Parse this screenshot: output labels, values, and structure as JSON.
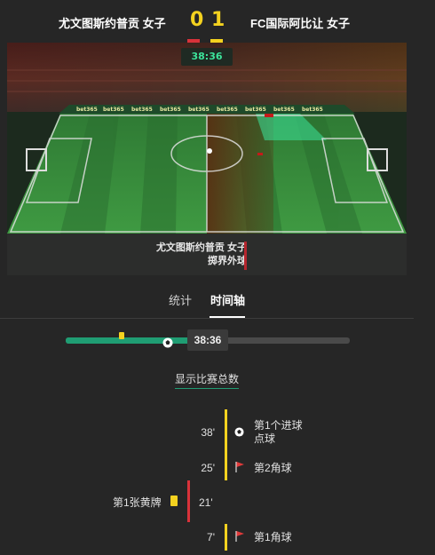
{
  "header": {
    "home_team": "尤文图斯约普贡 女子",
    "away_team": "FC国际阿比让 女子",
    "home_score": "0",
    "away_score": "1"
  },
  "pitch": {
    "clock": "38:36",
    "sponsor": "bet365",
    "event_team": "尤文图斯约普贡 女子",
    "event_desc": "掷界外球"
  },
  "tabs": {
    "stats": "统计",
    "timeline": "时间轴"
  },
  "progress": {
    "time": "38:36",
    "fraction": 0.43
  },
  "show_total": "显示比赛总数",
  "timeline": [
    {
      "minute": "38'",
      "side": "away",
      "icon": "football-icon",
      "line1": "第1个进球",
      "line2": "点球"
    },
    {
      "minute": "25'",
      "side": "away",
      "icon": "corner-flag-icon",
      "line1": "第2角球",
      "line2": ""
    },
    {
      "minute": "21'",
      "side": "home",
      "icon": "yellow-card-icon",
      "line1": "第1张黄牌",
      "line2": ""
    },
    {
      "minute": "7'",
      "side": "away",
      "icon": "corner-flag-icon",
      "line1": "第1角球",
      "line2": ""
    }
  ],
  "colors": {
    "home": "#d9323a",
    "away": "#f4d21f",
    "accent": "#1f9d73",
    "pitch": "#3a8a3a"
  }
}
